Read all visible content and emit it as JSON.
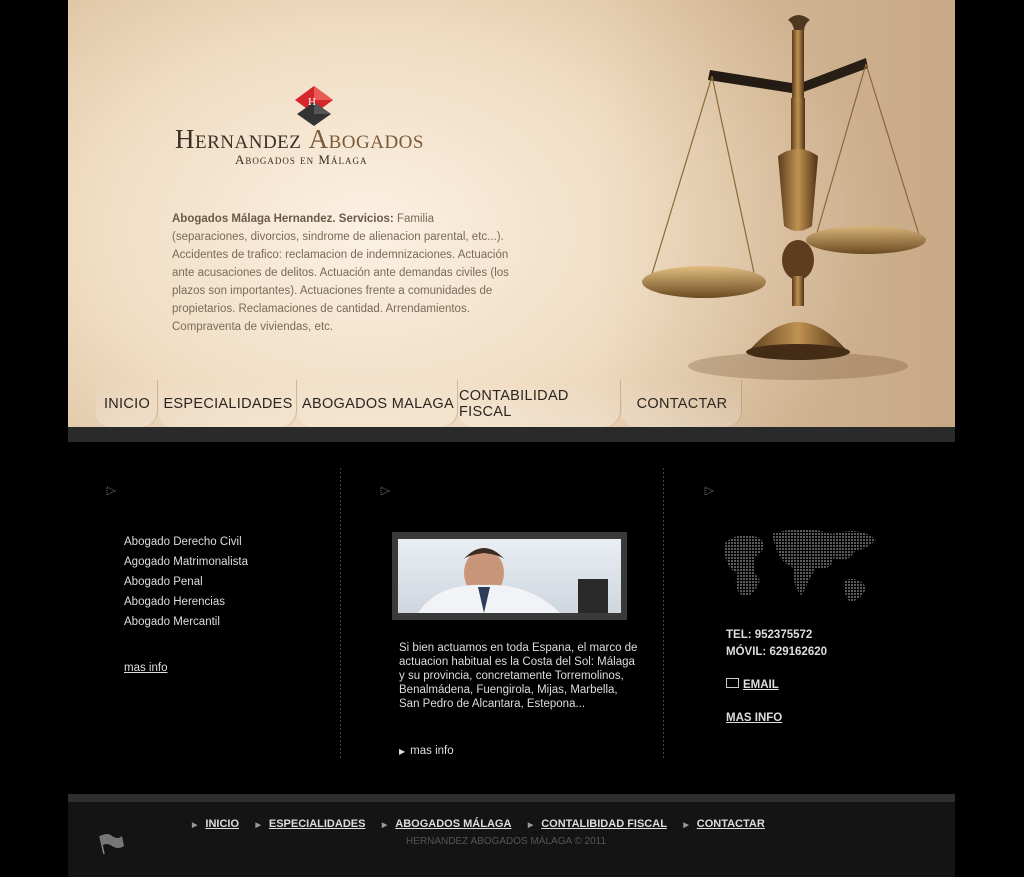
{
  "brand": {
    "name_part1": "Hernandez",
    "name_part2": "Abogados",
    "tagline": "Abogados en Málaga"
  },
  "intro": {
    "lead": "Abogados Málaga Hernandez. Servicios:",
    "text": " Familia (separaciones, divorcios, sindrome de alienacion parental, etc...). Accidentes de trafico: reclamacion de indemnizaciones. Actuación ante acusaciones de delitos. Actuación ante demandas civiles (los plazos son importantes). Actuaciones frente a comunidades de propietarios. Reclamaciones de cantidad. Arrendamientos. Compraventa de viviendas, etc."
  },
  "nav": {
    "items": [
      {
        "label": "INICIO"
      },
      {
        "label": "ESPECIALIDADES"
      },
      {
        "label": "ABOGADOS MALAGA"
      },
      {
        "label": "CONTABILIDAD FISCAL"
      },
      {
        "label": "CONTACTAR"
      }
    ]
  },
  "specialties": {
    "items": [
      "Abogado Derecho Civil",
      "Agogado Matrimonalista",
      "Abogado Penal",
      "Abogado Herencias",
      "Abogado Mercantil"
    ],
    "more": "mas info"
  },
  "area": {
    "text": "Si bien actuamos en toda Espana, el marco de actuacion habitual es la Costa del Sol: Málaga y su provincia, concretamente Torremolinos, Benalmádena, Fuengirola, Mijas, Marbella, San Pedro de Alcantara, Estepona...",
    "more": "mas info"
  },
  "contact": {
    "tel": "TEL: 952375572",
    "movil": "MÓVIL: 629162620",
    "email": "EMAIL",
    "more": "MAS INFO"
  },
  "footer": {
    "links": [
      "INICIO",
      "ESPECIALIDADES",
      "ABOGADOS MÁLAGA",
      "CONTALIBIDAD FISCAL",
      "CONTACTAR"
    ],
    "copyright": "HERNANDEZ ABOGADOS MÁLAGA © 2011"
  },
  "colors": {
    "background": "#000000",
    "header_light": "#fbf1e3",
    "header_dark": "#d9bd9b",
    "logo_red": "#d4262b",
    "text_light": "#dddddd"
  },
  "icons": [
    "logo-mark-icon",
    "scales-of-justice-icon",
    "arrow-bullet-icon",
    "world-map-icon",
    "email-icon",
    "flag-icon"
  ]
}
